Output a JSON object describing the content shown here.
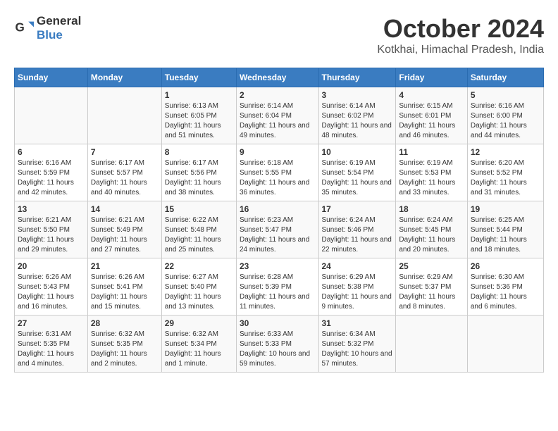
{
  "header": {
    "logo_general": "General",
    "logo_blue": "Blue",
    "month": "October 2024",
    "location": "Kotkhai, Himachal Pradesh, India"
  },
  "days_of_week": [
    "Sunday",
    "Monday",
    "Tuesday",
    "Wednesday",
    "Thursday",
    "Friday",
    "Saturday"
  ],
  "weeks": [
    [
      {
        "day": "",
        "info": ""
      },
      {
        "day": "",
        "info": ""
      },
      {
        "day": "1",
        "sunrise": "Sunrise: 6:13 AM",
        "sunset": "Sunset: 6:05 PM",
        "daylight": "Daylight: 11 hours and 51 minutes."
      },
      {
        "day": "2",
        "sunrise": "Sunrise: 6:14 AM",
        "sunset": "Sunset: 6:04 PM",
        "daylight": "Daylight: 11 hours and 49 minutes."
      },
      {
        "day": "3",
        "sunrise": "Sunrise: 6:14 AM",
        "sunset": "Sunset: 6:02 PM",
        "daylight": "Daylight: 11 hours and 48 minutes."
      },
      {
        "day": "4",
        "sunrise": "Sunrise: 6:15 AM",
        "sunset": "Sunset: 6:01 PM",
        "daylight": "Daylight: 11 hours and 46 minutes."
      },
      {
        "day": "5",
        "sunrise": "Sunrise: 6:16 AM",
        "sunset": "Sunset: 6:00 PM",
        "daylight": "Daylight: 11 hours and 44 minutes."
      }
    ],
    [
      {
        "day": "6",
        "sunrise": "Sunrise: 6:16 AM",
        "sunset": "Sunset: 5:59 PM",
        "daylight": "Daylight: 11 hours and 42 minutes."
      },
      {
        "day": "7",
        "sunrise": "Sunrise: 6:17 AM",
        "sunset": "Sunset: 5:57 PM",
        "daylight": "Daylight: 11 hours and 40 minutes."
      },
      {
        "day": "8",
        "sunrise": "Sunrise: 6:17 AM",
        "sunset": "Sunset: 5:56 PM",
        "daylight": "Daylight: 11 hours and 38 minutes."
      },
      {
        "day": "9",
        "sunrise": "Sunrise: 6:18 AM",
        "sunset": "Sunset: 5:55 PM",
        "daylight": "Daylight: 11 hours and 36 minutes."
      },
      {
        "day": "10",
        "sunrise": "Sunrise: 6:19 AM",
        "sunset": "Sunset: 5:54 PM",
        "daylight": "Daylight: 11 hours and 35 minutes."
      },
      {
        "day": "11",
        "sunrise": "Sunrise: 6:19 AM",
        "sunset": "Sunset: 5:53 PM",
        "daylight": "Daylight: 11 hours and 33 minutes."
      },
      {
        "day": "12",
        "sunrise": "Sunrise: 6:20 AM",
        "sunset": "Sunset: 5:52 PM",
        "daylight": "Daylight: 11 hours and 31 minutes."
      }
    ],
    [
      {
        "day": "13",
        "sunrise": "Sunrise: 6:21 AM",
        "sunset": "Sunset: 5:50 PM",
        "daylight": "Daylight: 11 hours and 29 minutes."
      },
      {
        "day": "14",
        "sunrise": "Sunrise: 6:21 AM",
        "sunset": "Sunset: 5:49 PM",
        "daylight": "Daylight: 11 hours and 27 minutes."
      },
      {
        "day": "15",
        "sunrise": "Sunrise: 6:22 AM",
        "sunset": "Sunset: 5:48 PM",
        "daylight": "Daylight: 11 hours and 25 minutes."
      },
      {
        "day": "16",
        "sunrise": "Sunrise: 6:23 AM",
        "sunset": "Sunset: 5:47 PM",
        "daylight": "Daylight: 11 hours and 24 minutes."
      },
      {
        "day": "17",
        "sunrise": "Sunrise: 6:24 AM",
        "sunset": "Sunset: 5:46 PM",
        "daylight": "Daylight: 11 hours and 22 minutes."
      },
      {
        "day": "18",
        "sunrise": "Sunrise: 6:24 AM",
        "sunset": "Sunset: 5:45 PM",
        "daylight": "Daylight: 11 hours and 20 minutes."
      },
      {
        "day": "19",
        "sunrise": "Sunrise: 6:25 AM",
        "sunset": "Sunset: 5:44 PM",
        "daylight": "Daylight: 11 hours and 18 minutes."
      }
    ],
    [
      {
        "day": "20",
        "sunrise": "Sunrise: 6:26 AM",
        "sunset": "Sunset: 5:43 PM",
        "daylight": "Daylight: 11 hours and 16 minutes."
      },
      {
        "day": "21",
        "sunrise": "Sunrise: 6:26 AM",
        "sunset": "Sunset: 5:41 PM",
        "daylight": "Daylight: 11 hours and 15 minutes."
      },
      {
        "day": "22",
        "sunrise": "Sunrise: 6:27 AM",
        "sunset": "Sunset: 5:40 PM",
        "daylight": "Daylight: 11 hours and 13 minutes."
      },
      {
        "day": "23",
        "sunrise": "Sunrise: 6:28 AM",
        "sunset": "Sunset: 5:39 PM",
        "daylight": "Daylight: 11 hours and 11 minutes."
      },
      {
        "day": "24",
        "sunrise": "Sunrise: 6:29 AM",
        "sunset": "Sunset: 5:38 PM",
        "daylight": "Daylight: 11 hours and 9 minutes."
      },
      {
        "day": "25",
        "sunrise": "Sunrise: 6:29 AM",
        "sunset": "Sunset: 5:37 PM",
        "daylight": "Daylight: 11 hours and 8 minutes."
      },
      {
        "day": "26",
        "sunrise": "Sunrise: 6:30 AM",
        "sunset": "Sunset: 5:36 PM",
        "daylight": "Daylight: 11 hours and 6 minutes."
      }
    ],
    [
      {
        "day": "27",
        "sunrise": "Sunrise: 6:31 AM",
        "sunset": "Sunset: 5:35 PM",
        "daylight": "Daylight: 11 hours and 4 minutes."
      },
      {
        "day": "28",
        "sunrise": "Sunrise: 6:32 AM",
        "sunset": "Sunset: 5:35 PM",
        "daylight": "Daylight: 11 hours and 2 minutes."
      },
      {
        "day": "29",
        "sunrise": "Sunrise: 6:32 AM",
        "sunset": "Sunset: 5:34 PM",
        "daylight": "Daylight: 11 hours and 1 minute."
      },
      {
        "day": "30",
        "sunrise": "Sunrise: 6:33 AM",
        "sunset": "Sunset: 5:33 PM",
        "daylight": "Daylight: 10 hours and 59 minutes."
      },
      {
        "day": "31",
        "sunrise": "Sunrise: 6:34 AM",
        "sunset": "Sunset: 5:32 PM",
        "daylight": "Daylight: 10 hours and 57 minutes."
      },
      {
        "day": "",
        "info": ""
      },
      {
        "day": "",
        "info": ""
      }
    ]
  ]
}
